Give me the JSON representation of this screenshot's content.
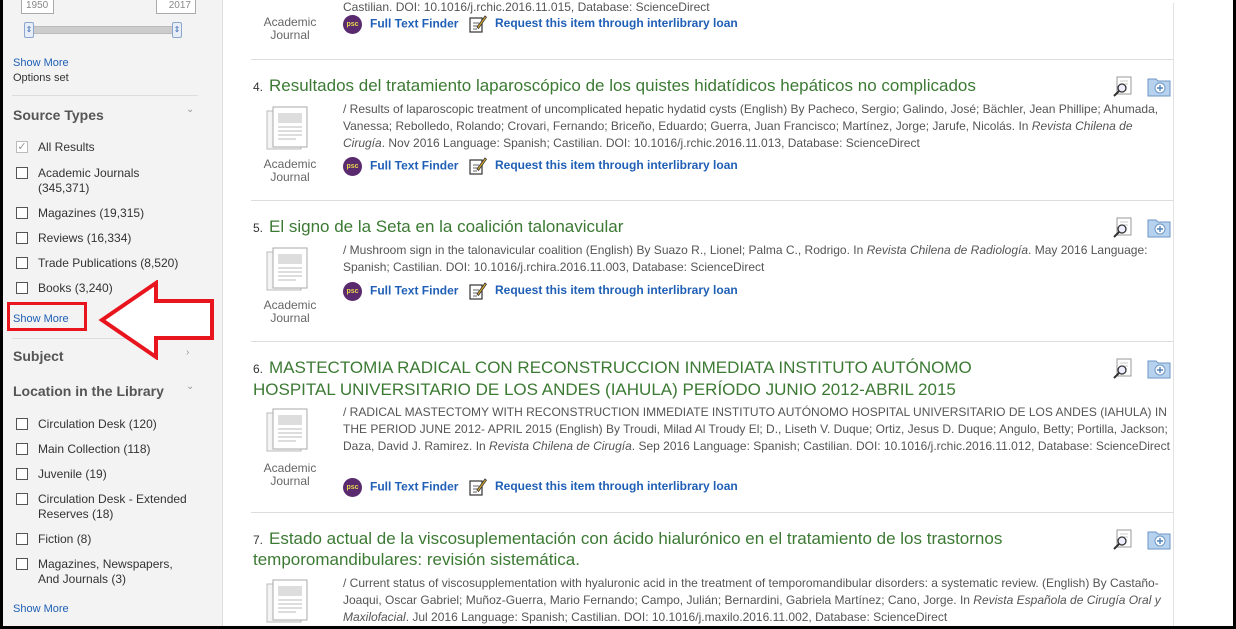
{
  "sidebar": {
    "date_from": "1950",
    "date_to": "2017",
    "show_more_top": "Show More",
    "options_set": "Options set",
    "source_types": {
      "heading": "Source Types",
      "items": [
        {
          "label": "All Results",
          "count": ""
        },
        {
          "label": "Academic Journals",
          "count": "(345,371)"
        },
        {
          "label": "Magazines",
          "count": "(19,315)"
        },
        {
          "label": "Reviews",
          "count": "(16,334)"
        },
        {
          "label": "Trade Publications",
          "count": "(8,520)"
        },
        {
          "label": "Books",
          "count": "(3,240)"
        }
      ],
      "show_more": "Show More"
    },
    "subject": {
      "heading": "Subject"
    },
    "location": {
      "heading": "Location in the Library",
      "items": [
        {
          "label": "Circulation Desk",
          "count": "(120)"
        },
        {
          "label": "Main Collection",
          "count": "(118)"
        },
        {
          "label": "Juvenile",
          "count": "(19)"
        },
        {
          "label": "Circulation Desk - Extended Reserves",
          "count": "(18)"
        },
        {
          "label": "Fiction",
          "count": "(8)"
        },
        {
          "label": "Magazines, Newspapers, And Journals",
          "count": "(3)"
        }
      ],
      "show_more": "Show More"
    }
  },
  "annotation": {
    "color": "#e8141e"
  },
  "results": {
    "type_label_1": "Academic",
    "type_label_2": "Journal",
    "full_text_label": "Full Text Finder",
    "full_text_badge": "psc",
    "ill_label": "Request this item through interlibrary loan",
    "top_partial_meta": "Castilian. DOI: 10.1016/j.rchic.2016.11.015, Database: ScienceDirect",
    "records": [
      {
        "num": "4.",
        "title": "Resultados del tratamiento laparoscópico de los quistes hidatídicos hepáticos no complicados",
        "meta_pre": "/ Results of laparoscopic treatment of uncomplicated hepatic hydatid cysts (English) By Pacheco, Sergio; Galindo, José; Bächler, Jean Phillipe; Ahumada, Vanessa; Rebolledo, Rolando; Crovari, Fernando; Briceño, Eduardo; Guerra, Juan Francisco; Martínez, Jorge; Jarufe, Nicolás. In ",
        "journal": "Revista Chilena de Cirugía",
        "meta_post": ". Nov 2016 Language: Spanish; Castilian. DOI: 10.1016/j.rchic.2016.11.013, Database: ScienceDirect"
      },
      {
        "num": "5.",
        "title": "El signo de la Seta en la coalición talonavicular",
        "meta_pre": "/ Mushroom sign in the talonavicular coalition (English) By Suazo R., Lionel; Palma C., Rodrigo. In ",
        "journal": "Revista Chilena de Radiología",
        "meta_post": ". May 2016 Language: Spanish; Castilian. DOI: 10.1016/j.rchira.2016.11.003, Database: ScienceDirect"
      },
      {
        "num": "6.",
        "title_line1": "MASTECTOMIA RADICAL CON RECONSTRUCCION INMEDIATA INSTITUTO AUTÓNOMO",
        "title_line2": "HOSPITAL UNIVERSITARIO DE LOS ANDES (IAHULA) PERÍODO JUNIO 2012-ABRIL 2015",
        "meta_pre": "/ RADICAL MASTECTOMY WITH RECONSTRUCTION IMMEDIATE INSTITUTO AUTÓNOMO HOSPITAL UNIVERSITARIO DE LOS ANDES (IAHULA) IN THE PERIOD JUNE 2012- APRIL 2015 (English) By Troudi, Milad Al Troudy El; D., Liseth V. Duque; Ortiz, Jesus D. Duque; Angulo, Betty; Portilla, Jackson; Daza, David J. Ramirez. In ",
        "journal": "Revista Chilena de Cirugía",
        "meta_post": ". Sep 2016 Language: Spanish; Castilian. DOI: 10.1016/j.rchic.2016.11.012, Database: ScienceDirect"
      },
      {
        "num": "7.",
        "title_line1": "Estado actual de la viscosuplementación con ácido hialurónico en el tratamiento de los trastornos",
        "title_line2": "temporomandibulares: revisión sistemática.",
        "meta_pre": "/ Current status of viscosupplementation with hyaluronic acid in the treatment of temporomandibular disorders: a systematic review. (English) By Castaño-Joaqui, Oscar Gabriel; Muñoz-Guerra, Mario Fernando; Campo, Julián; Bernardini, Gabriela Martínez; Cano, Jorge. In ",
        "journal": "Revista Española de Cirugía Oral y Maxilofacial",
        "meta_post": ". Jul 2016 Language: Spanish; Castilian. DOI: 10.1016/j.maxilo.2016.11.002, Database: ScienceDirect"
      }
    ]
  }
}
